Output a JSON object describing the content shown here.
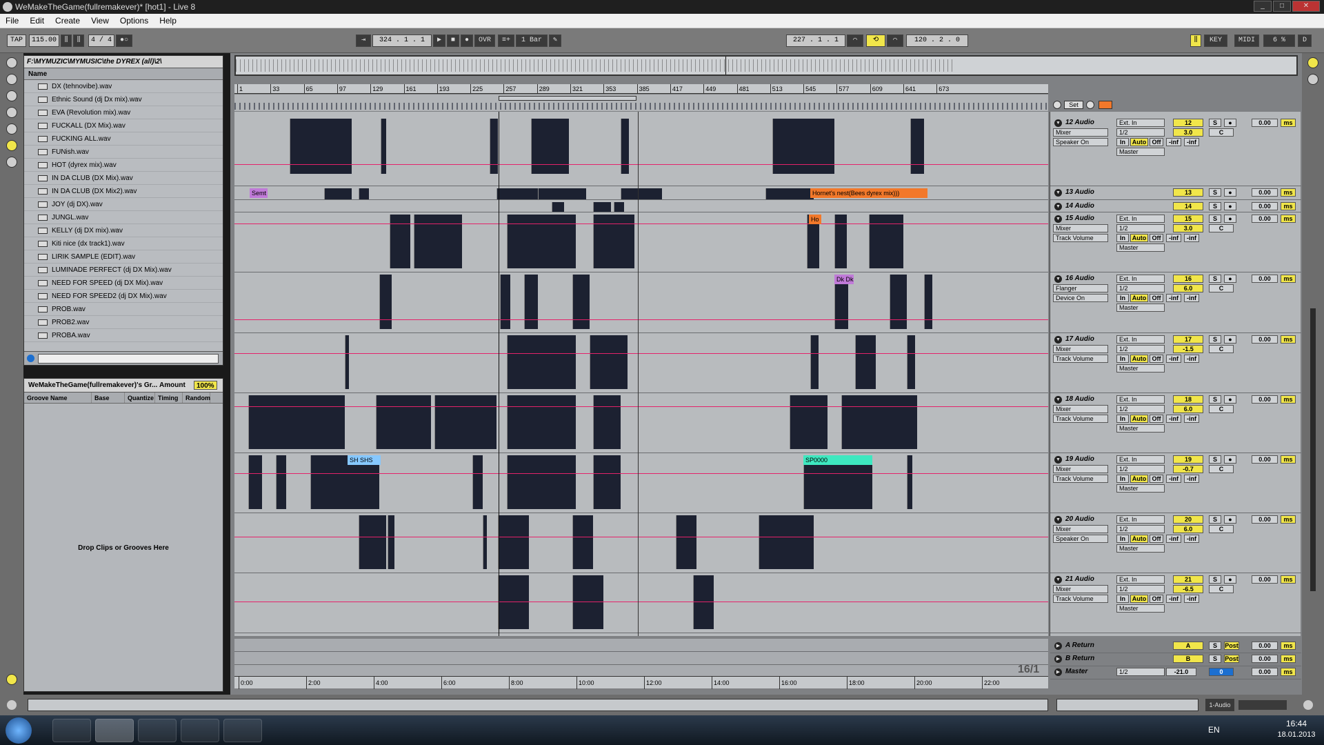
{
  "window": {
    "title": "WeMakeTheGame(fullremakever)*  [hot1] - Live 8"
  },
  "menu": [
    "File",
    "Edit",
    "Create",
    "View",
    "Options",
    "Help"
  ],
  "transport": {
    "tap": "TAP",
    "tempo": "115.00",
    "signature": "4 / 4",
    "arrangement_position": "324 .  1 .  1",
    "ovr": "OVR",
    "quantize": "1 Bar",
    "loop_start": "227 .  1 .  1",
    "loop_length": "120 .  2 .  0",
    "key": "KEY",
    "midi": "MIDI",
    "cpu": "6 %",
    "d": "D"
  },
  "browser": {
    "path": "F:\\MYMUZIC\\MYMUSIC\\the DYREX (all)\\2\\",
    "column": "Name",
    "files": [
      "DX (tehnovibe).wav",
      "Ethnic Sound (dj Dx mix).wav",
      "EVA (Revolution mix).wav",
      "FUCKALL (DX Mix).wav",
      "FUCKING ALL.wav",
      "FUNish.wav",
      "HOT (dyrex mix).wav",
      "IN DA CLUB (DX Mix).wav",
      "IN DA CLUB (DX Mix2).wav",
      "JOY (dj DX).wav",
      "JUNGL.wav",
      "KELLY (dj DX mix).wav",
      "Kiti nice (dx track1).wav",
      "LIRIK SAMPLE (EDIT).wav",
      "LUMINADE PERFECT (dj DX Mix).wav",
      "NEED FOR SPEED (dj DX Mix).wav",
      "NEED FOR SPEED2 (dj DX Mix).wav",
      "PROB.wav",
      "PROB2.wav",
      "PROBA.wav"
    ]
  },
  "groove": {
    "title": "WeMakeTheGame(fullremakever)'s Gr...",
    "amount_label": "Amount",
    "amount": "100%",
    "columns": [
      "Groove Name",
      "Base",
      "Quantize",
      "Timing",
      "Random"
    ],
    "empty": "Drop Clips or Grooves Here"
  },
  "ruler": [
    "1",
    "33",
    "65",
    "97",
    "129",
    "161",
    "193",
    "225",
    "257",
    "289",
    "321",
    "353",
    "385",
    "417",
    "449",
    "481",
    "513",
    "545",
    "577",
    "609",
    "641",
    "673"
  ],
  "timeline": [
    "0:00",
    "2:00",
    "4:00",
    "6:00",
    "8:00",
    "10:00",
    "12:00",
    "14:00",
    "16:00",
    "18:00",
    "20:00",
    "22:00"
  ],
  "signature_marker": "16/1",
  "set_label": "Set",
  "clip_labels": {
    "semt": "Semt",
    "hornet": "Hornet's nest(Bees dyrex mix)))",
    "ho": "Ho",
    "sh": "SH SHS",
    "sp": "SP0000",
    "dk": "Dk Dk"
  },
  "tracks": [
    {
      "name": "12 Audio",
      "in": "Ext. In",
      "num": "12",
      "vol": "3.0",
      "dev": "Mixer",
      "param": "Speaker On",
      "ch": "1/2",
      "pan": "C",
      "send": "0.00"
    },
    {
      "name": "13 Audio",
      "num": "13",
      "send": "0.00"
    },
    {
      "name": "14 Audio",
      "num": "14",
      "send": "0.00"
    },
    {
      "name": "15 Audio",
      "in": "Ext. In",
      "num": "15",
      "vol": "3.0",
      "dev": "Mixer",
      "param": "Track Volume",
      "ch": "1/2",
      "pan": "C",
      "send": "0.00"
    },
    {
      "name": "16 Audio",
      "in": "Ext. In",
      "num": "16",
      "vol": "6.0",
      "dev": "Flanger",
      "param": "Device On",
      "ch": "1/2",
      "pan": "C",
      "send": "0.00"
    },
    {
      "name": "17 Audio",
      "in": "Ext. In",
      "num": "17",
      "vol": "-1.5",
      "dev": "Mixer",
      "param": "Track Volume",
      "ch": "1/2",
      "pan": "C",
      "send": "0.00"
    },
    {
      "name": "18 Audio",
      "in": "Ext. In",
      "num": "18",
      "vol": "6.0",
      "dev": "Mixer",
      "param": "Track Volume",
      "ch": "1/2",
      "pan": "C",
      "send": "0.00"
    },
    {
      "name": "19 Audio",
      "in": "Ext. In",
      "num": "19",
      "vol": "-0.7",
      "dev": "Mixer",
      "param": "Track Volume",
      "ch": "1/2",
      "pan": "C",
      "send": "0.00"
    },
    {
      "name": "20 Audio",
      "in": "Ext. In",
      "num": "20",
      "vol": "6.0",
      "dev": "Mixer",
      "param": "Speaker On",
      "ch": "1/2",
      "pan": "C",
      "send": "0.00"
    },
    {
      "name": "21 Audio",
      "in": "Ext. In",
      "num": "21",
      "vol": "-6.5",
      "dev": "Mixer",
      "param": "Track Volume",
      "ch": "1/2",
      "pan": "C",
      "send": "0.00"
    }
  ],
  "returns": [
    {
      "name": "A Return",
      "num": "A",
      "post": "Post",
      "send": "0.00"
    },
    {
      "name": "B Return",
      "num": "B",
      "post": "Post",
      "send": "0.00"
    },
    {
      "name": "Master",
      "ch": "1/2",
      "vol": "-21.0",
      "num": "0",
      "send": "0.00"
    }
  ],
  "mixer_labels": {
    "in": "In",
    "auto": "Auto",
    "off": "Off",
    "inf": "-inf",
    "master": "Master",
    "s": "S",
    "ms": "ms"
  },
  "status": {
    "track": "1-Audio"
  },
  "taskbar": {
    "lang": "EN",
    "time": "16:44",
    "date": "18.01.2013"
  },
  "colors": {
    "automation": "#e4226a",
    "clip": "#1c2131",
    "accent": "#f1e64a",
    "orange": "#f2782a",
    "cyan": "#3ee8c0"
  }
}
